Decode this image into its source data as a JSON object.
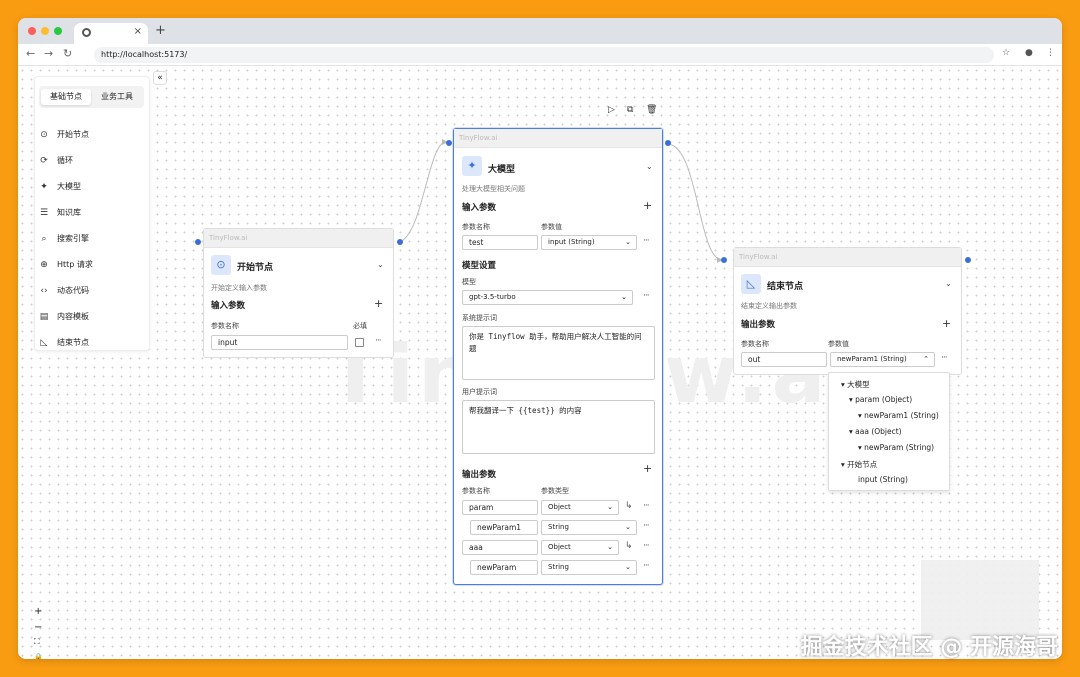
{
  "browser": {
    "url": "http://localhost:5173/",
    "new_tab": "+",
    "tab_close": "×"
  },
  "sidebar": {
    "tabs": [
      "基础节点",
      "业务工具"
    ],
    "items": [
      {
        "icon": "start-icon",
        "label": "开始节点"
      },
      {
        "icon": "loop-icon",
        "label": "循环"
      },
      {
        "icon": "llm-icon",
        "label": "大模型"
      },
      {
        "icon": "knowledge-icon",
        "label": "知识库"
      },
      {
        "icon": "search-icon",
        "label": "搜索引擎"
      },
      {
        "icon": "http-icon",
        "label": "Http 请求"
      },
      {
        "icon": "code-icon",
        "label": "动态代码"
      },
      {
        "icon": "template-icon",
        "label": "内容模板"
      },
      {
        "icon": "end-icon",
        "label": "结束节点"
      }
    ],
    "collapse": "«"
  },
  "watermark": "Tinyflow.ai",
  "start_node": {
    "header": "TinyFlow.ai",
    "title": "开始节点",
    "desc": "开始定义输入参数",
    "section": "输入参数",
    "col_name": "参数名称",
    "col_required": "必填",
    "param_value": "input"
  },
  "llm_node": {
    "header": "TinyFlow.ai",
    "title": "大模型",
    "desc": "处理大模型相关问题",
    "input_section": "输入参数",
    "col_name": "参数名称",
    "col_value": "参数值",
    "input_name": "test",
    "input_value": "input (String)",
    "model_section": "模型设置",
    "model_label": "模型",
    "model_value": "gpt-3.5-turbo",
    "system_label": "系统提示词",
    "system_prompt": "你是 Tinyflow 助手，帮助用户解决人工智能的问题",
    "user_label": "用户提示词",
    "user_prompt": "帮我翻译一下 {{test}} 的内容",
    "output_section": "输出参数",
    "col_type": "参数类型",
    "outputs": [
      {
        "name": "param",
        "type": "Object"
      },
      {
        "name": "newParam1",
        "type": "String"
      },
      {
        "name": "aaa",
        "type": "Object"
      },
      {
        "name": "newParam",
        "type": "String"
      }
    ]
  },
  "end_node": {
    "header": "TinyFlow.ai",
    "title": "结束节点",
    "desc": "结束定义输出参数",
    "section": "输出参数",
    "col_name": "参数名称",
    "col_value": "参数值",
    "param_name": "out",
    "param_value": "newParam1 (String)"
  },
  "popup": {
    "items": [
      "大模型",
      "param (Object)",
      "newParam1 (String)",
      "aaa (Object)",
      "newParam (String)",
      "开始节点",
      "input (String)"
    ]
  },
  "zoom_controls": [
    "+",
    "−",
    "⛶",
    "🔒"
  ],
  "footer_watermark": "掘金技术社区 @ 开源海哥"
}
